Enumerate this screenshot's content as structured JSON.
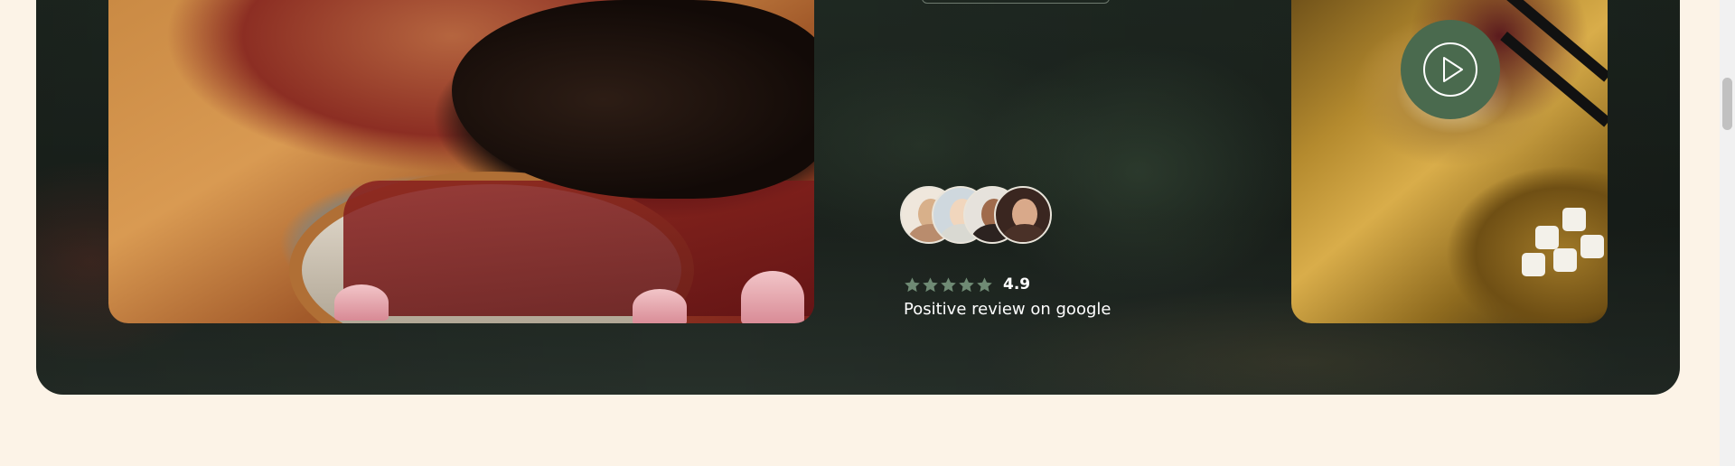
{
  "review": {
    "rating": "4.9",
    "stars_filled": 5,
    "stars_total": 5,
    "text": "Positive review on google",
    "star_color": "#6f8a74"
  },
  "avatars": [
    {
      "name": "reviewer-avatar-1"
    },
    {
      "name": "reviewer-avatar-2"
    },
    {
      "name": "reviewer-avatar-3"
    },
    {
      "name": "reviewer-avatar-4"
    }
  ],
  "video": {
    "button_icon": "play-icon",
    "button_color": "#4a6a4e"
  },
  "colors": {
    "page_background": "#fcf3e7",
    "hero_background": "#1e2620",
    "text": "#ffffff"
  }
}
